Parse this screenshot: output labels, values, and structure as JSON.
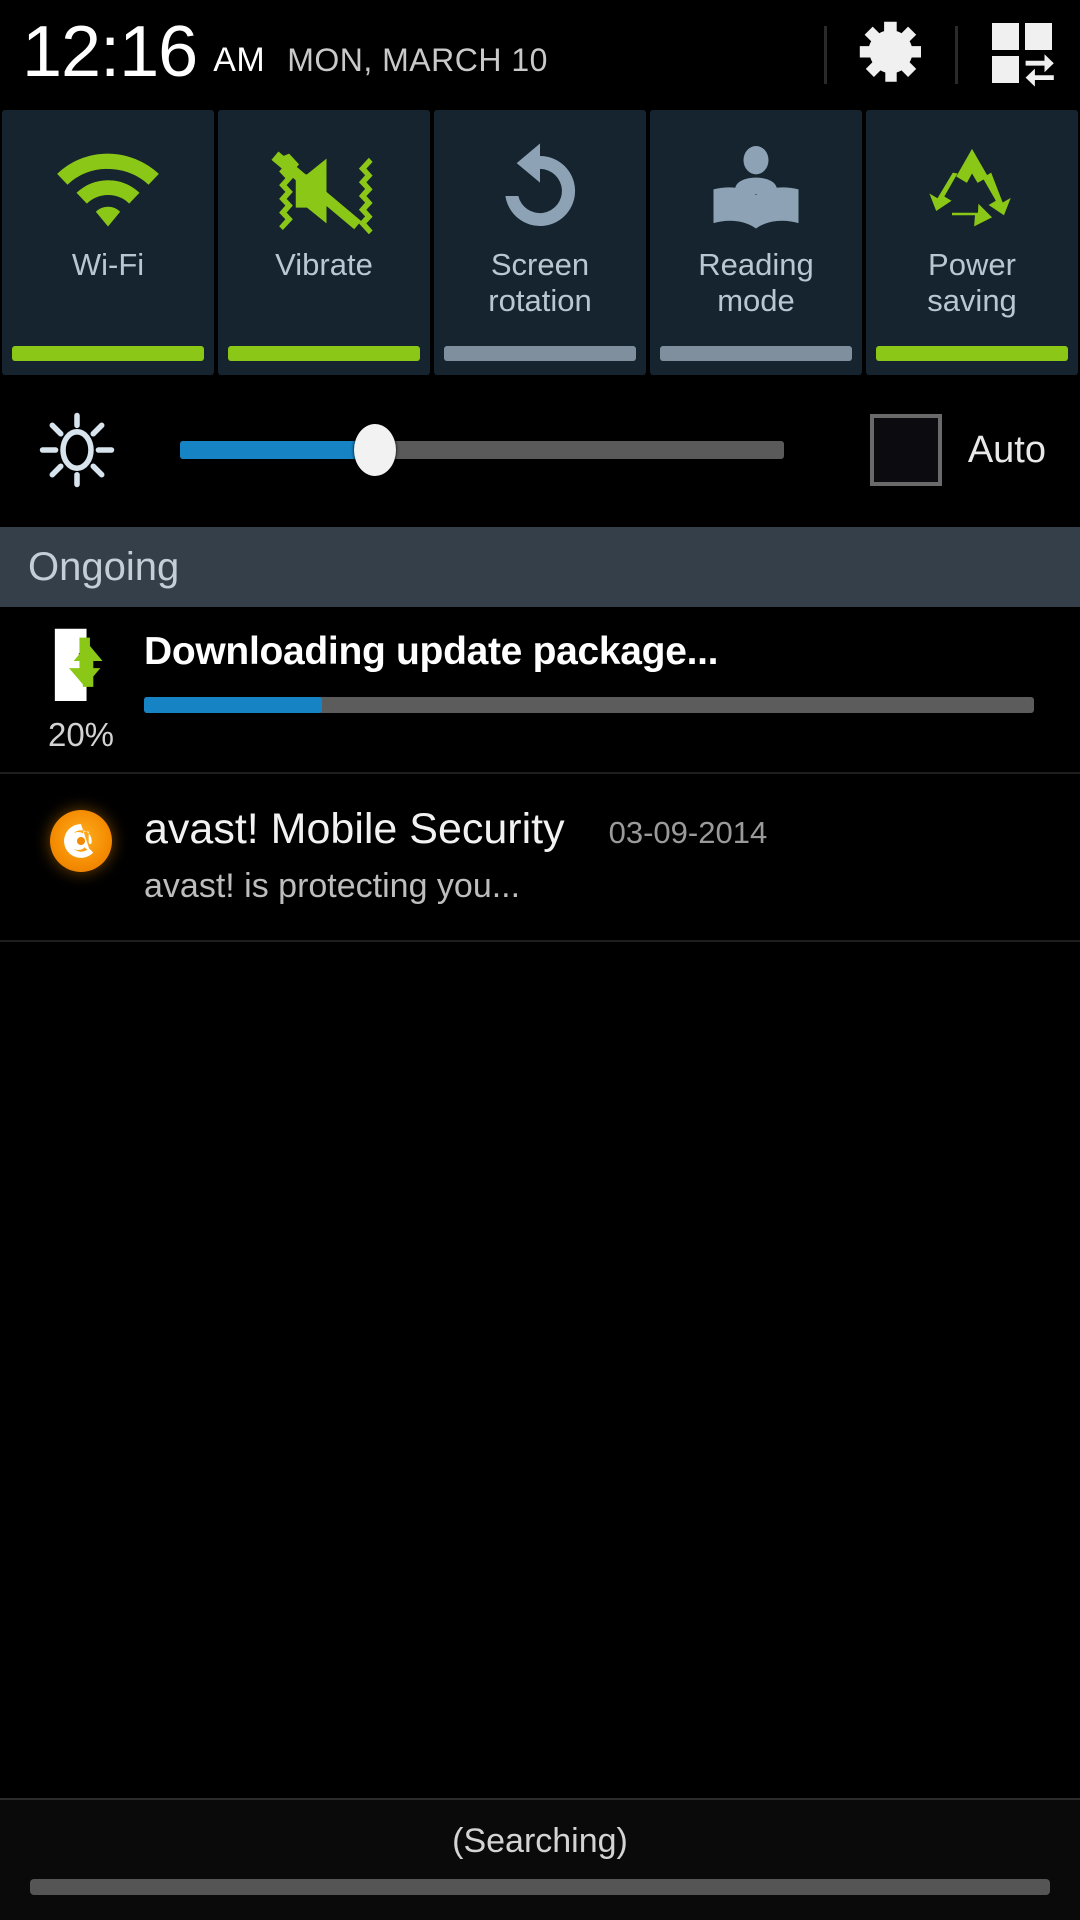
{
  "statusbar": {
    "time": "12:16",
    "ampm": "AM",
    "date": "MON, MARCH 10",
    "settings_icon": "gear-icon",
    "edit_icon": "quick-settings-grid-icon"
  },
  "quick_settings": {
    "tiles": [
      {
        "label": "Wi-Fi",
        "icon": "wifi-icon",
        "state": "on",
        "state_color": "#8bc717"
      },
      {
        "label": "Vibrate",
        "icon": "vibrate-icon",
        "state": "on",
        "state_color": "#8bc717"
      },
      {
        "label": "Screen\nrotation",
        "icon": "screen-rotation-icon",
        "state": "off",
        "state_color": "#7f8f9e"
      },
      {
        "label": "Reading\nmode",
        "icon": "reading-mode-icon",
        "state": "off",
        "state_color": "#7f8f9e"
      },
      {
        "label": "Power\nsaving",
        "icon": "power-saving-icon",
        "state": "on",
        "state_color": "#8bc717"
      }
    ]
  },
  "brightness": {
    "icon": "brightness-icon",
    "value_percent": 31,
    "fill_color": "#1683c4",
    "auto_label": "Auto",
    "auto_checked": false
  },
  "notifications": {
    "section_label": "Ongoing",
    "items": [
      {
        "type": "download",
        "icon": "download-to-phone-icon",
        "title": "Downloading update package...",
        "percent_label": "20%",
        "progress_percent": 20,
        "progress_color": "#1683c4"
      },
      {
        "type": "app",
        "icon": "avast-icon",
        "title": "avast! Mobile Security",
        "date": "03-09-2014",
        "text": "avast! is protecting you..."
      }
    ]
  },
  "bottom_bar": {
    "status_text": "(Searching)",
    "handle": "drag-handle"
  }
}
